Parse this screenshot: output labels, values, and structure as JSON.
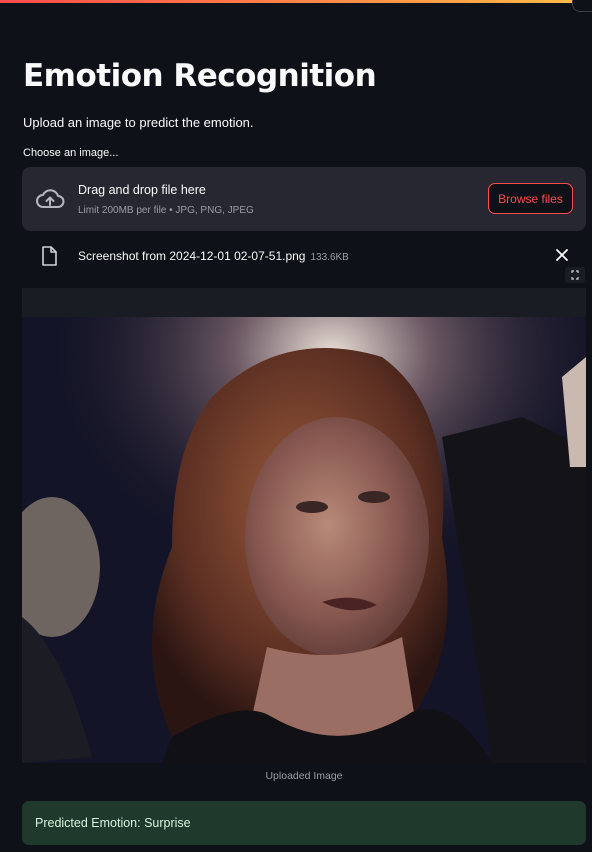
{
  "app": {
    "title": "Emotion Recognition",
    "subtitle": "Upload an image to predict the emotion.",
    "accent_color": "#ff4b4b",
    "background_color": "#0e1117"
  },
  "uploader": {
    "label": "Choose an image...",
    "drop_text": "Drag and drop file here",
    "limit_text": "Limit 200MB per file • JPG, PNG, JPEG",
    "browse_label": "Browse files",
    "upload_icon": "cloud-upload-icon"
  },
  "uploaded_file": {
    "name": "Screenshot from 2024-12-01 02-07-51.png",
    "size": "133.6KB",
    "file_icon": "file-icon",
    "remove_icon": "close-icon"
  },
  "image": {
    "caption": "Uploaded Image",
    "fullscreen_icon": "fullscreen-icon"
  },
  "result": {
    "text": "Predicted Emotion: Surprise",
    "color": "#1f3a2d"
  }
}
